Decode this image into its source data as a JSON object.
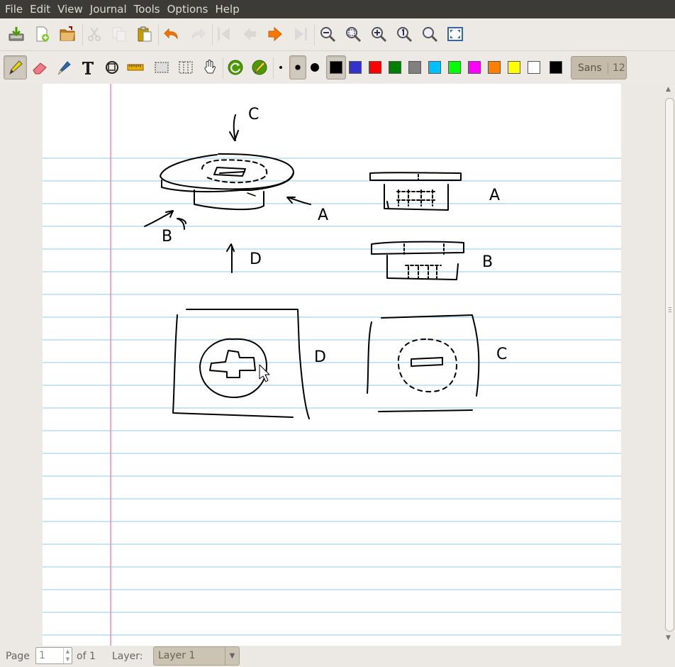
{
  "menu": [
    "File",
    "Edit",
    "View",
    "Journal",
    "Tools",
    "Options",
    "Help"
  ],
  "toolbar1": {
    "buttons": [
      {
        "name": "save-icon",
        "enabled": true
      },
      {
        "name": "new-page-icon",
        "enabled": true
      },
      {
        "name": "open-icon",
        "enabled": true
      },
      {
        "name": "cut-icon",
        "enabled": false
      },
      {
        "name": "copy-icon",
        "enabled": false
      },
      {
        "name": "paste-icon",
        "enabled": true
      },
      {
        "name": "undo-icon",
        "enabled": true
      },
      {
        "name": "redo-icon",
        "enabled": false
      },
      {
        "name": "first-page-icon",
        "enabled": false
      },
      {
        "name": "previous-page-icon",
        "enabled": false
      },
      {
        "name": "next-page-icon",
        "enabled": true
      },
      {
        "name": "last-page-icon",
        "enabled": false
      },
      {
        "name": "zoom-out-icon",
        "enabled": true
      },
      {
        "name": "zoom-fit-icon",
        "enabled": true
      },
      {
        "name": "zoom-in-icon",
        "enabled": true
      },
      {
        "name": "zoom-100-icon",
        "enabled": true
      },
      {
        "name": "zoom-custom-icon",
        "enabled": true
      },
      {
        "name": "fullscreen-icon",
        "enabled": true
      }
    ]
  },
  "toolbar2": {
    "tools": [
      "pen-icon",
      "eraser-icon",
      "highlighter-icon",
      "text-icon",
      "shape-recognizer-icon",
      "ruler-icon",
      "select-rectangle-icon",
      "select-region-icon",
      "hand-icon",
      "default-pen-icon",
      "pen-settings-icon"
    ],
    "active_tool": "pen-icon",
    "thickness": [
      "fine",
      "medium",
      "thick"
    ],
    "active_thickness": "medium",
    "colors": [
      "#000000",
      "#3333cc",
      "#ff0000",
      "#008000",
      "#808080",
      "#00c0ff",
      "#00ff00",
      "#ff00ff",
      "#ff8000",
      "#ffff00",
      "#ffffff",
      "#000000"
    ],
    "active_color_index": 0,
    "font_name": "Sans",
    "font_size": "12"
  },
  "drawing": {
    "labels": [
      "C",
      "A",
      "B",
      "D",
      "A",
      "B",
      "D",
      "C"
    ]
  },
  "status": {
    "page_label": "Page",
    "page_value": "1",
    "of_label": "of 1",
    "layer_label": "Layer:",
    "layer_value": "Layer 1"
  }
}
